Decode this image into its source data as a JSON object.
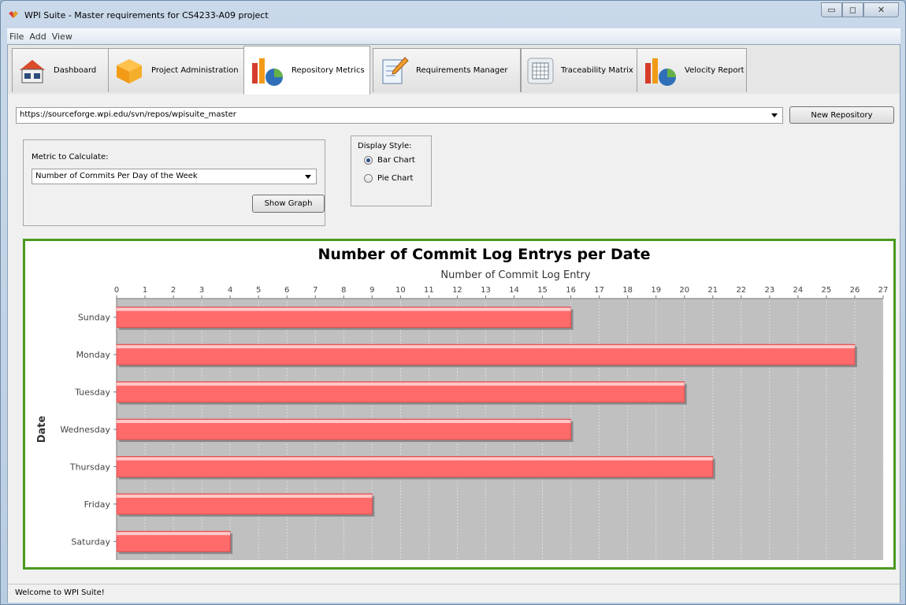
{
  "window": {
    "title": "WPI Suite - Master requirements for CS4233-A09 project"
  },
  "menu": [
    "File",
    "Add",
    "View"
  ],
  "tabs": [
    {
      "label": "Dashboard",
      "icon": "house-icon"
    },
    {
      "label": "Project Administration",
      "icon": "box-icon"
    },
    {
      "label": "Repository Metrics",
      "icon": "metrics-chart-icon",
      "active": true
    },
    {
      "label": "Requirements Manager",
      "icon": "notepad-pencil-icon"
    },
    {
      "label": "Traceability Matrix",
      "icon": "matrix-grid-icon"
    },
    {
      "label": "Velocity Report",
      "icon": "velocity-chart-icon"
    }
  ],
  "repository": {
    "url": "https://sourceforge.wpi.edu/svn/repos/wpisuite_master",
    "new_button": "New Repository"
  },
  "metric": {
    "label": "Metric to Calculate:",
    "selected": "Number of Commits Per Day of the Week",
    "show_button": "Show Graph"
  },
  "display_style": {
    "label": "Display Style:",
    "options": [
      {
        "label": "Bar Chart",
        "selected": true
      },
      {
        "label": "Pie Chart",
        "selected": false
      }
    ]
  },
  "chart_data": {
    "type": "bar",
    "orientation": "horizontal",
    "title": "Number of Commit Log Entrys per Date",
    "xlabel": "Number of Commit Log Entry",
    "ylabel": "Date",
    "xlim": [
      0,
      27
    ],
    "x_ticks": [
      0,
      1,
      2,
      3,
      4,
      5,
      6,
      7,
      8,
      9,
      10,
      11,
      12,
      13,
      14,
      15,
      16,
      17,
      18,
      19,
      20,
      21,
      22,
      23,
      24,
      25,
      26,
      27
    ],
    "categories": [
      "Sunday",
      "Monday",
      "Tuesday",
      "Wednesday",
      "Thursday",
      "Friday",
      "Saturday"
    ],
    "values": [
      16,
      26,
      20,
      16,
      21,
      9,
      4
    ],
    "bar_color": "#ff6a6a",
    "plot_background": "#c0c0c0",
    "grid": true,
    "axis_position": "top"
  },
  "status": {
    "text": "Welcome to WPI Suite!"
  },
  "colors": {
    "chart_border": "#4a9a1e"
  }
}
